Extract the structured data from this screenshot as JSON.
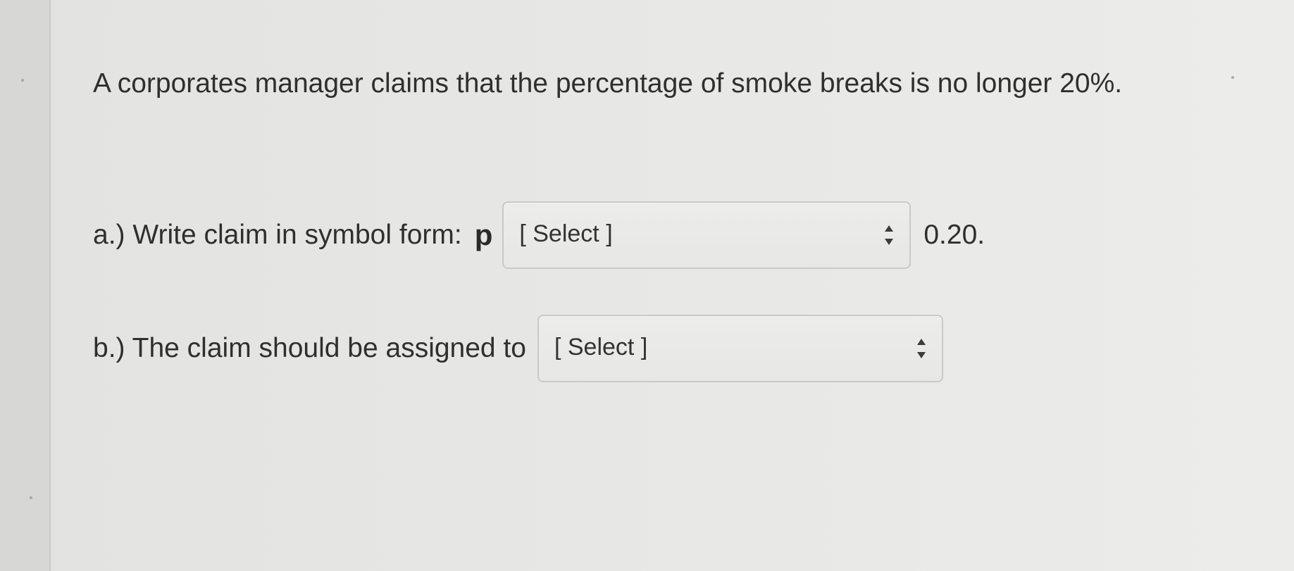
{
  "question": {
    "text": "A corporates manager claims that the percentage of smoke breaks is no longer 20%."
  },
  "part_a": {
    "prompt": "a.) Write claim in symbol form:",
    "symbol": "p",
    "select_value": "[ Select ]",
    "suffix": "0.20.",
    "icon": "updown-arrows-icon"
  },
  "part_b": {
    "prompt": "b.) The claim should be assigned to",
    "select_value": "[ Select ]",
    "icon": "updown-arrows-icon"
  }
}
